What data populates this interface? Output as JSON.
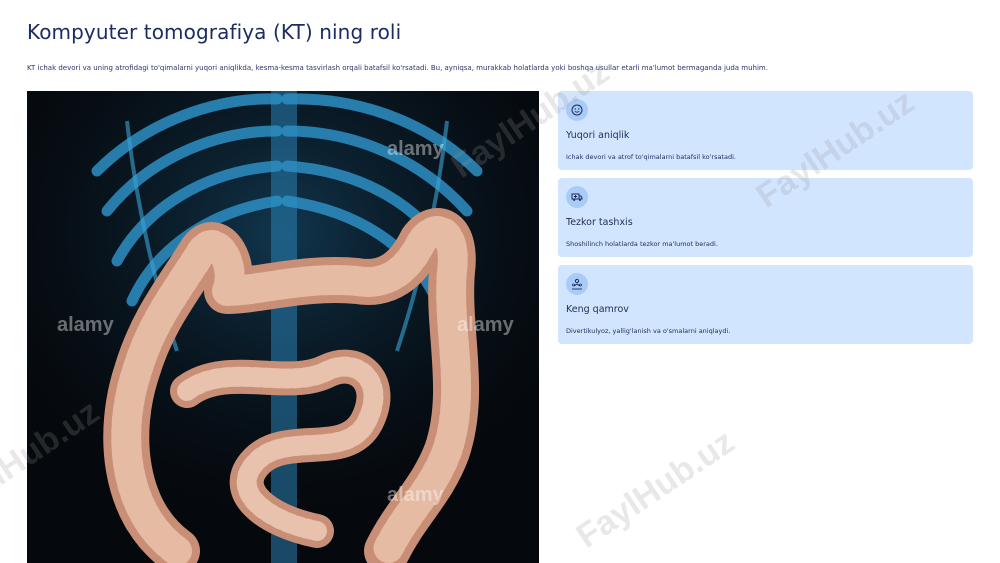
{
  "slide": {
    "title": "Kompyuter tomografiya (KT) ning roli",
    "subtitle": "KT ichak devori va uning atrofidagi to'qimalarni yuqori aniqlikda, kesma-kesma tasvirlash orqali batafsil ko'rsatadi. Bu, ayniqsa, murakkab holatlarda yoki boshqa usullar etarli ma'lumot bermaganda juda muhim."
  },
  "image": {
    "watermark_text": "alamy"
  },
  "cards": [
    {
      "icon": "smile-icon",
      "title": "Yuqori aniqlik",
      "description": "Ichak devori va atrof to'qimalarni batafsil ko'rsatadi."
    },
    {
      "icon": "ambulance-icon",
      "title": "Tezkor tashxis",
      "description": "Shoshilinch holatlarda tezkor ma'lumot beradi."
    },
    {
      "icon": "people-icon",
      "title": "Keng qamrov",
      "description": "Divertikulyoz, yallig'lanish va o'smalarni aniqlaydi."
    }
  ],
  "watermark": {
    "text": "FaylHub.uz"
  },
  "colors": {
    "title": "#1c2c64",
    "card_bg": "#d2e5ff",
    "icon_bg": "#a9ccf7",
    "scan_bg": "#05080c",
    "ribs": "#2d8fc4",
    "colon": "#d9a88e"
  }
}
